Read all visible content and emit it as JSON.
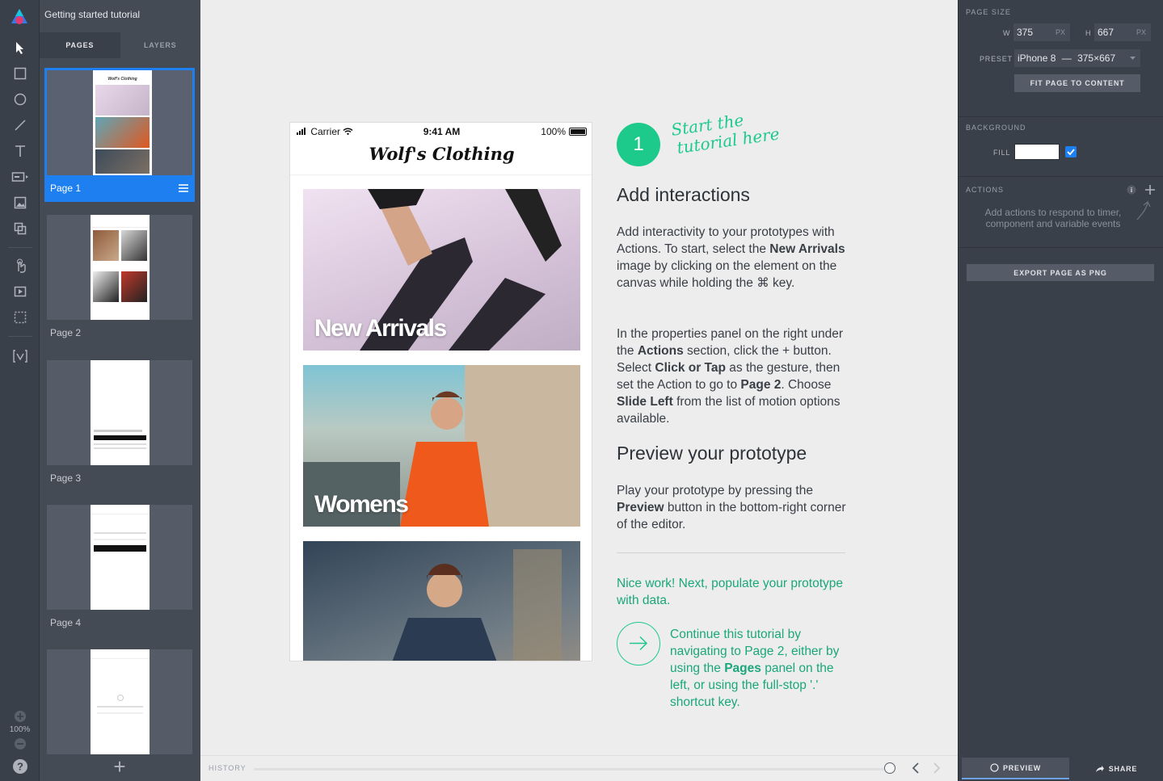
{
  "document": {
    "title": "Getting started tutorial"
  },
  "left_panel": {
    "tabs": [
      {
        "label": "PAGES",
        "active": true
      },
      {
        "label": "LAYERS",
        "active": false
      }
    ],
    "pages": [
      {
        "name": "Page 1",
        "selected": true
      },
      {
        "name": "Page 2",
        "selected": false
      },
      {
        "name": "Page 3",
        "selected": false
      },
      {
        "name": "Page 4",
        "selected": false
      },
      {
        "name": "",
        "selected": false
      }
    ]
  },
  "toolbar": {
    "zoom": "100%"
  },
  "phone": {
    "carrier": "Carrier",
    "time": "9:41 AM",
    "battery": "100%",
    "brand": "Wolf's Clothing",
    "cards": [
      {
        "label": "New Arrivals"
      },
      {
        "label": "Womens"
      },
      {
        "label": ""
      }
    ]
  },
  "tutorial": {
    "step_number": "1",
    "handwritten_line1": "Start the",
    "handwritten_line2": "tutorial here",
    "heading1": "Add interactions",
    "para1_a": "Add interactivity to your prototypes with Actions. To start, select the ",
    "para1_b": "New Arrivals",
    "para1_c": " image by clicking on the element on the canvas while holding the ⌘ key.",
    "para2_a": "In the properties panel on the right under the ",
    "para2_b": "Actions",
    "para2_c": " section, click the + button. Select ",
    "para2_d": "Click or Tap",
    "para2_e": " as the gesture, then set the Action to go to ",
    "para2_f": "Page 2",
    "para2_g": ". Choose ",
    "para2_h": "Slide Left",
    "para2_i": " from the list of motion options available.",
    "heading2": "Preview your prototype",
    "para3_a": "Play your prototype by pressing the ",
    "para3_b": "Preview",
    "para3_c": " button in the bottom-right corner of the editor.",
    "nice_work": "Nice work! Next, populate your prototype with data.",
    "continue_a": "Continue this tutorial by navigating to Page 2, either by using the ",
    "continue_b": "Pages",
    "continue_c": " panel on the left, or using the full-stop '.' shortcut key."
  },
  "history": {
    "label": "HISTORY"
  },
  "properties": {
    "page_size": {
      "title": "PAGE SIZE",
      "w_label": "W",
      "w_value": "375",
      "h_label": "H",
      "h_value": "667",
      "unit": "PX"
    },
    "preset": {
      "label": "PRESET",
      "device": "iPhone 8",
      "dash": "—",
      "size": "375×667"
    },
    "fit_button": "FIT PAGE TO CONTENT",
    "background": {
      "title": "BACKGROUND",
      "fill_label": "FILL",
      "fill_color": "#ffffff",
      "checked": true
    },
    "actions": {
      "title": "ACTIONS",
      "hint": "Add actions to respond to timer, component and variable events"
    },
    "export_button": "EXPORT PAGE AS PNG",
    "preview_label": "PREVIEW",
    "share_label": "SHARE"
  },
  "colors": {
    "accent_green": "#1ec98c",
    "selection_blue": "#1e7ff0",
    "panel_dark": "#3a404a"
  }
}
